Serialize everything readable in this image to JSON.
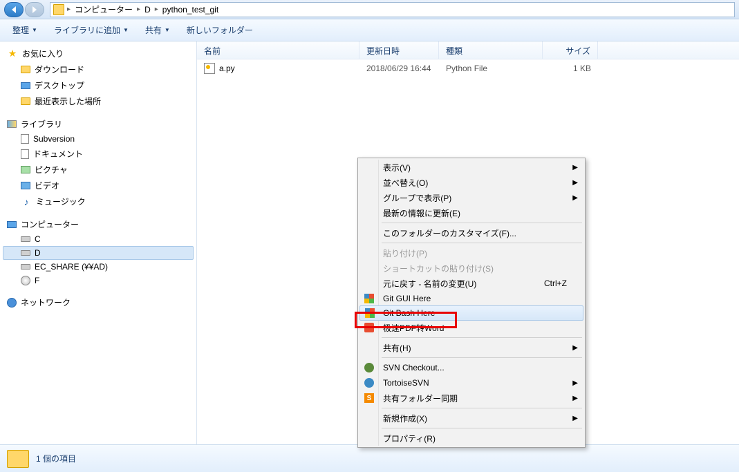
{
  "breadcrumb": {
    "item1": "コンピューター",
    "item2": "D",
    "item3": "python_test_git"
  },
  "toolbar": {
    "organize": "整理",
    "add_library": "ライブラリに追加",
    "share": "共有",
    "new_folder": "新しいフォルダー"
  },
  "sidebar": {
    "favorites": {
      "header": "お気に入り",
      "downloads": "ダウンロード",
      "desktop": "デスクトップ",
      "recent": "最近表示した場所"
    },
    "libraries": {
      "header": "ライブラリ",
      "subversion": "Subversion",
      "documents": "ドキュメント",
      "pictures": "ピクチャ",
      "videos": "ビデオ",
      "music": "ミュージック"
    },
    "computer": {
      "header": "コンピューター",
      "c": "C",
      "d": "D",
      "ec": "EC_SHARE (¥¥AD)",
      "f": "F"
    },
    "network": {
      "header": "ネットワーク"
    }
  },
  "columns": {
    "name": "名前",
    "date": "更新日時",
    "type": "種類",
    "size": "サイズ"
  },
  "files": [
    {
      "name": "a.py",
      "date": "2018/06/29 16:44",
      "type": "Python File",
      "size": "1 KB"
    }
  ],
  "status": {
    "count": "1 個の項目"
  },
  "context_menu": {
    "view": "表示(V)",
    "sort": "並べ替え(O)",
    "group": "グループで表示(P)",
    "refresh": "最新の情報に更新(E)",
    "customize": "このフォルダーのカスタマイズ(F)...",
    "paste": "貼り付け(P)",
    "paste_shortcut": "ショートカットの貼り付け(S)",
    "undo": "元に戻す - 名前の変更(U)",
    "undo_key": "Ctrl+Z",
    "git_gui": "Git GUI Here",
    "git_bash": "Git Bash Here",
    "pdf": "极速PDF转Word",
    "share": "共有(H)",
    "svn_checkout": "SVN Checkout...",
    "tortoise": "TortoiseSVN",
    "sync": "共有フォルダー同期",
    "new": "新規作成(X)",
    "properties": "プロパティ(R)"
  }
}
